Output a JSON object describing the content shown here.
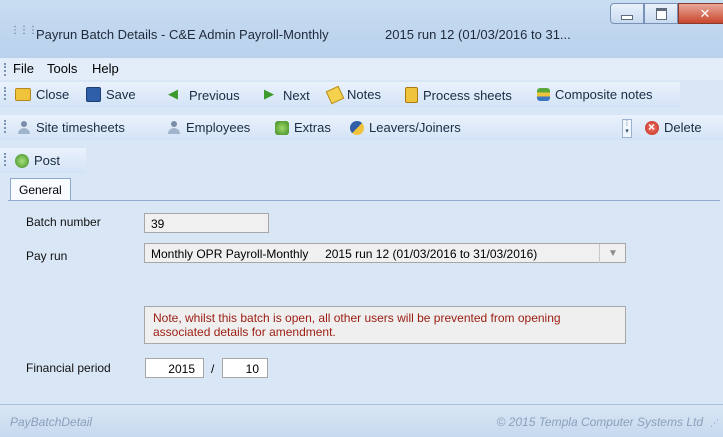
{
  "window": {
    "title": "Payrun Batch Details - C&E Admin Payroll-Monthly",
    "run_info": "2015 run 12 (01/03/2016 to 31..."
  },
  "menu": [
    "File",
    "Tools",
    "Help"
  ],
  "toolbar1": {
    "close": "Close",
    "save": "Save",
    "previous": "Previous",
    "next": "Next",
    "notes": "Notes",
    "process_sheets": "Process sheets",
    "composite_notes": "Composite notes"
  },
  "toolbar2": {
    "site_timesheets": "Site timesheets",
    "employees": "Employees",
    "extras": "Extras",
    "leavers_joiners": "Leavers/Joiners",
    "delete": "Delete"
  },
  "toolbar3": {
    "post": "Post"
  },
  "tabs": [
    {
      "label": "General"
    }
  ],
  "form": {
    "batch_number_label": "Batch number",
    "batch_number": "39",
    "pay_run_label": "Pay run",
    "pay_run_name": "Monthly OPR Payroll-Monthly",
    "pay_run_period": "2015 run 12 (01/03/2016 to 31/03/2016)",
    "note": "Note, whilst this batch is open, all other users will be prevented from opening associated details for amendment.",
    "financial_period_label": "Financial period",
    "financial_year": "2015",
    "separator": "/",
    "financial_period": "10"
  },
  "status": {
    "left": "PayBatchDetail",
    "right": "© 2015 Templa Computer Systems Ltd"
  },
  "colors": {
    "note_text": "#9b1c10",
    "background": "#d8e6f5"
  }
}
